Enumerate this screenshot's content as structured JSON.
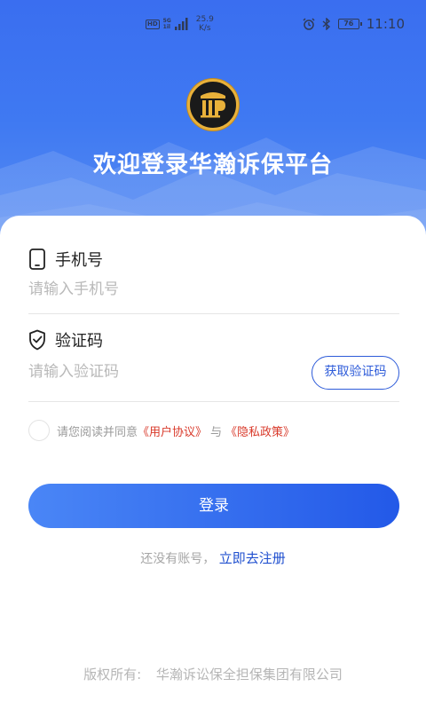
{
  "status_bar": {
    "hd": "HD",
    "net_type": "5G",
    "net_sub": "1il",
    "speed_value": "25.9",
    "speed_unit": "K/s",
    "battery": "76",
    "time": "11:10"
  },
  "header": {
    "welcome": "欢迎登录华瀚诉保平台"
  },
  "phone": {
    "label": "手机号",
    "placeholder": "请输入手机号",
    "value": ""
  },
  "code": {
    "label": "验证码",
    "placeholder": "请输入验证码",
    "value": "",
    "get_code_label": "获取验证码"
  },
  "agreement": {
    "prefix": "请您阅读并同意",
    "user_agreement": "《用户协议》",
    "and": "与",
    "privacy_policy": "《隐私政策》",
    "checked": false
  },
  "login": {
    "button_label": "登录"
  },
  "register": {
    "prompt": "还没有账号，",
    "link": "立即去注册"
  },
  "footer": {
    "copyright_label": "版权所有:",
    "company": "华瀚诉讼保全担保集团有限公司"
  },
  "colors": {
    "primary": "#2d5bd9",
    "hero_top": "#3a6ef0",
    "link_red": "#d93a2b",
    "logo_gold": "#e9b13a"
  },
  "icons": {
    "phone": "mobile-phone-icon",
    "shield": "shield-check-icon",
    "logo": "pillar-logo-icon"
  }
}
